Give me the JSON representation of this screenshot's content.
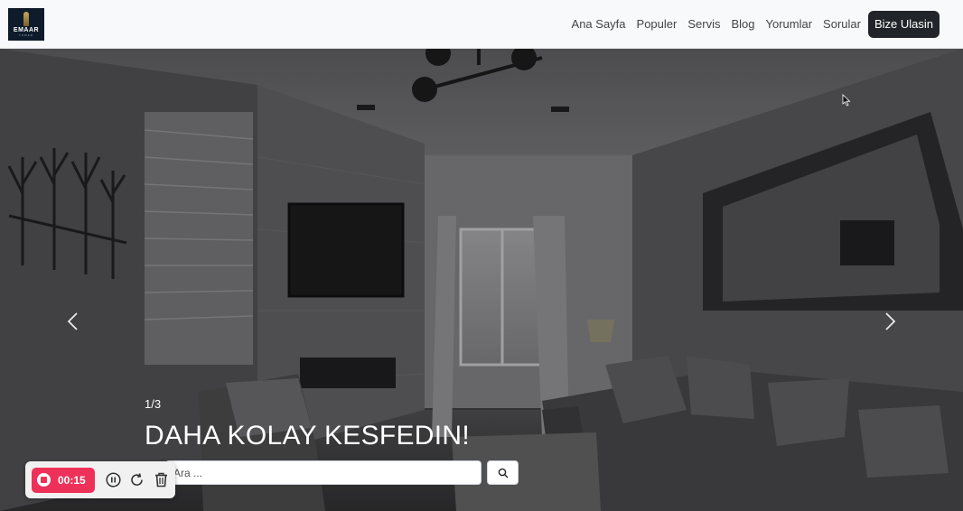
{
  "navbar": {
    "logo": {
      "text": "EMAAR",
      "subtext": "TOWER"
    },
    "links": [
      "Ana Sayfa",
      "Populer",
      "Servis",
      "Blog",
      "Yorumlar",
      "Sorular"
    ],
    "cta_label": "Bize Ulasin"
  },
  "hero": {
    "slide_counter": "1/3",
    "title": "DAHA KOLAY KESFEDIN!",
    "search": {
      "value": "Ara ...",
      "icon": "search-icon"
    },
    "prev_icon": "chevron-left-icon",
    "next_icon": "chevron-right-icon"
  },
  "recorder": {
    "time": "00:15",
    "icons": [
      "stop-icon",
      "pause-icon",
      "restart-icon",
      "trash-icon"
    ],
    "accent": "#ee3158"
  },
  "colors": {
    "nav_bg": "#f8f9fa",
    "cta_bg": "#212529"
  }
}
